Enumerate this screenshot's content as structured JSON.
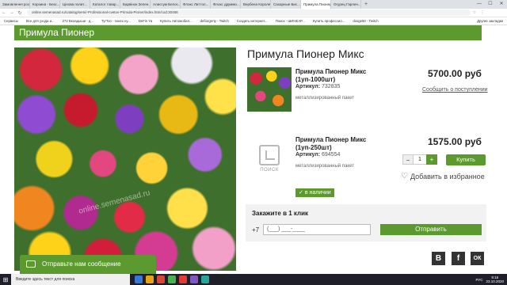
{
  "browser": {
    "tabs": [
      {
        "label": "Замовлення роз..."
      },
      {
        "label": "Корзина - Безс..."
      },
      {
        "label": "Цінова полит..."
      },
      {
        "label": "Каталог товар..."
      },
      {
        "label": "Барвінок Зелен..."
      },
      {
        "label": "Алиссум Белос..."
      },
      {
        "label": "Флокс Литтол..."
      },
      {
        "label": "Флокс друммо..."
      },
      {
        "label": "Вербена Королев..."
      },
      {
        "label": "Сахарные Бис..."
      },
      {
        "label": "Примула Пионер..."
      },
      {
        "label": "Огурец Гарлен..."
      }
    ],
    "new_tab": "+",
    "window_controls": [
      "—",
      "☐",
      "✕"
    ],
    "url": "online.semenasad.ru/catalog/semi/-Professional-cvetov-Primula-Pioner/index.htm/cod:30488",
    "bookmarks": [
      "Сервисы",
      "Все для ухода и...",
      "272 Вкладыши - д...",
      "TyrTon - поиск ну...",
      "DeFin Ya",
      "Купить Автомобил...",
      "defiorgerty - Twitch",
      "Создать интернет...",
      "Поиск - ШИНЕАР...",
      "Купить профессио...",
      "dosge60 - Twitch"
    ],
    "bookmarks_other": "Другие закладки"
  },
  "page": {
    "header": "Примула Пионер",
    "product_title": "Примула Пионер Микс",
    "watermark": "online.semenasad.ru",
    "article_label": "Артикул:",
    "variants": [
      {
        "name": "Примула Пионер Микс (1уп-1000шт)",
        "article": "732835",
        "pack": "металлизированный пакет",
        "price": "5700.00 руб",
        "notify_link": "Сообщить о поступлении"
      },
      {
        "name": "Примула Пионер Микс (1уп-250шт)",
        "article": "694554",
        "pack": "металлизированный пакет",
        "price": "1575.00 руб",
        "placeholder_text": "ПОИСК",
        "qty_minus": "−",
        "qty_value": "1",
        "qty_plus": "+",
        "buy_label": "Купить",
        "wishlist_label": "Добавить в избранное",
        "stock_label": "в наличии"
      }
    ],
    "quick_order": {
      "title": "Закажите в 1 клик",
      "prefix": "+7",
      "phone_placeholder": "(___) ___-____",
      "submit_label": "Отправить"
    },
    "social": [
      "В",
      "f",
      "ОК"
    ],
    "chat_label": "Отправьте нам сообщение"
  },
  "taskbar": {
    "search_placeholder": "Введите здесь текст для поиска",
    "tray_lang": "РУС",
    "time": "9:15",
    "date": "23.10.2020",
    "app_colors": [
      "#3a78d8",
      "#e8a317",
      "#db4437",
      "#4caf50",
      "#e53935",
      "#7e57c2",
      "#26a69a"
    ]
  },
  "colors": {
    "accent_green": "#5c9a2f",
    "text_dark": "#222222"
  }
}
